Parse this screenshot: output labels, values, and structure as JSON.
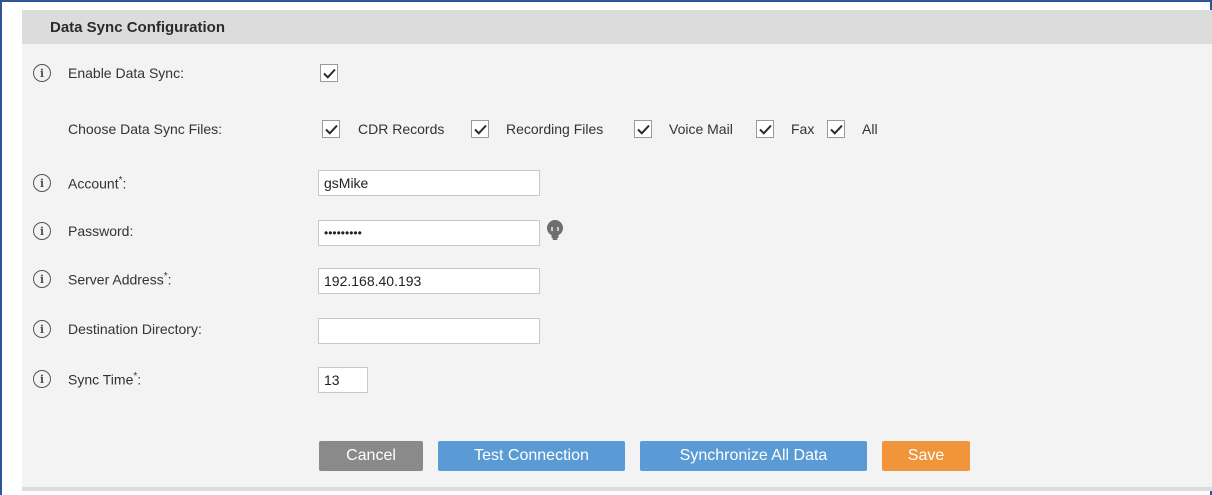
{
  "panel": {
    "title": "Data Sync Configuration"
  },
  "fields": {
    "enable": {
      "label": "Enable Data Sync:",
      "checked": true
    },
    "files": {
      "label": "Choose Data Sync Files:",
      "options": [
        "CDR Records",
        "Recording Files",
        "Voice Mail",
        "Fax",
        "All"
      ]
    },
    "account": {
      "label": "Account",
      "required_mark": "*",
      "suffix": ":",
      "value": "gsMike"
    },
    "password": {
      "label": "Password:",
      "value": "•••••••••"
    },
    "server": {
      "label": "Server Address",
      "required_mark": "*",
      "suffix": ":",
      "value": "192.168.40.193"
    },
    "destination": {
      "label": "Destination Directory:",
      "value": ""
    },
    "sync_time": {
      "label": "Sync Time",
      "required_mark": "*",
      "suffix": ":",
      "value": "13"
    }
  },
  "info_icon_glyph": "i",
  "buttons": {
    "cancel": "Cancel",
    "test": "Test Connection",
    "sync_all": "Synchronize All Data",
    "save": "Save"
  },
  "colors": {
    "cancel": "#8a8a8a",
    "primary": "#5b9bd5",
    "save": "#f0953a",
    "header": "#dcdcdc",
    "frame": "#2f5597"
  }
}
